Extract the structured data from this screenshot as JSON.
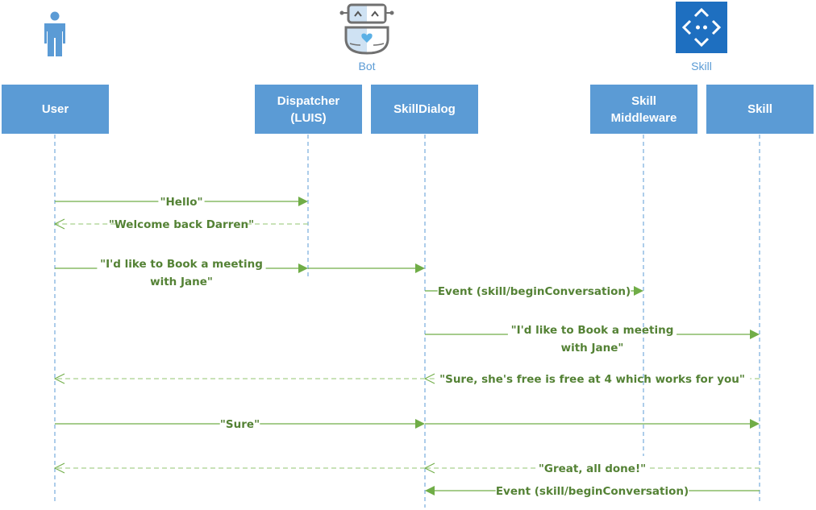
{
  "groups": {
    "bot_label": "Bot",
    "skill_label": "Skill"
  },
  "participants": [
    {
      "id": "user",
      "label": "User"
    },
    {
      "id": "dispatcher",
      "label": "Dispatcher\n(LUIS)"
    },
    {
      "id": "skilldialog",
      "label": "SkillDialog"
    },
    {
      "id": "middleware",
      "label": "Skill\nMiddleware"
    },
    {
      "id": "skill",
      "label": "Skill"
    }
  ],
  "messages": [
    {
      "from": "user",
      "to": "dispatcher",
      "style": "sync",
      "label": "\"Hello\""
    },
    {
      "from": "dispatcher",
      "to": "user",
      "style": "reply",
      "label": "\"Welcome back Darren\""
    },
    {
      "from": "user",
      "to": "dispatcher",
      "style": "sync",
      "label": "\"I'd like to Book a meeting\nwith Jane\""
    },
    {
      "from": "dispatcher",
      "to": "skilldialog",
      "style": "sync",
      "label": ""
    },
    {
      "from": "skilldialog",
      "to": "middleware",
      "style": "sync",
      "label": "Event (skill/beginConversation)"
    },
    {
      "from": "skilldialog",
      "to": "skill",
      "style": "sync",
      "label": "\"I'd like to Book a meeting\nwith Jane\""
    },
    {
      "from": "skill",
      "to": "skilldialog",
      "style": "reply",
      "label": "\"Sure, she's free is free at 4 which works for you\""
    },
    {
      "from": "skilldialog",
      "to": "user",
      "style": "reply",
      "label": ""
    },
    {
      "from": "user",
      "to": "skilldialog",
      "style": "sync",
      "label": "\"Sure\""
    },
    {
      "from": "skilldialog",
      "to": "skill",
      "style": "sync",
      "label": ""
    },
    {
      "from": "skill",
      "to": "skilldialog",
      "style": "reply",
      "label": "\"Great, all done!\""
    },
    {
      "from": "skilldialog",
      "to": "user",
      "style": "reply",
      "label": ""
    },
    {
      "from": "skill",
      "to": "skilldialog",
      "style": "sync",
      "label": "Event (skill/beginConversation)"
    }
  ],
  "colors": {
    "participant_fill": "#5b9bd5",
    "lifeline": "#5b9bd5",
    "message": "#70ad47",
    "message_text": "#548235",
    "reply": "#a9d18e",
    "skill_icon": "#1e6fc0"
  }
}
